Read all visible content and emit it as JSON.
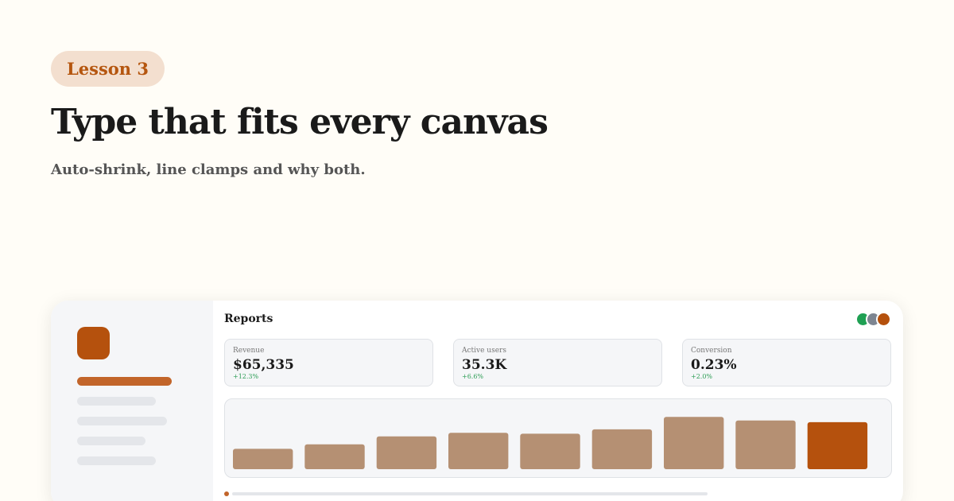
{
  "header": {
    "badge": "Lesson 3",
    "title": "Type that fits every canvas",
    "subtitle": "Auto-shrink, line clamps and why both."
  },
  "app": {
    "page_title": "Reports",
    "avatars": [
      {
        "color": "#1fa053"
      },
      {
        "color": "#7d8591"
      },
      {
        "color": "#b5510d"
      }
    ],
    "stats": [
      {
        "label": "Revenue",
        "value": "$65,335",
        "delta": "+12.3%"
      },
      {
        "label": "Active users",
        "value": "35.3K",
        "delta": "+6.6%"
      },
      {
        "label": "Conversion",
        "value": "0.23%",
        "delta": "+2.0%"
      }
    ],
    "progress": 0
  },
  "colors": {
    "accent": "#b5510d",
    "bar": "#b59073",
    "positive": "#2f9e57"
  },
  "chart_data": {
    "type": "bar",
    "categories": [],
    "values": [
      23,
      28,
      37,
      41,
      40,
      45,
      59,
      55,
      53
    ],
    "highlight_index": 8,
    "ylim": [
      0,
      70
    ],
    "grid": false
  }
}
